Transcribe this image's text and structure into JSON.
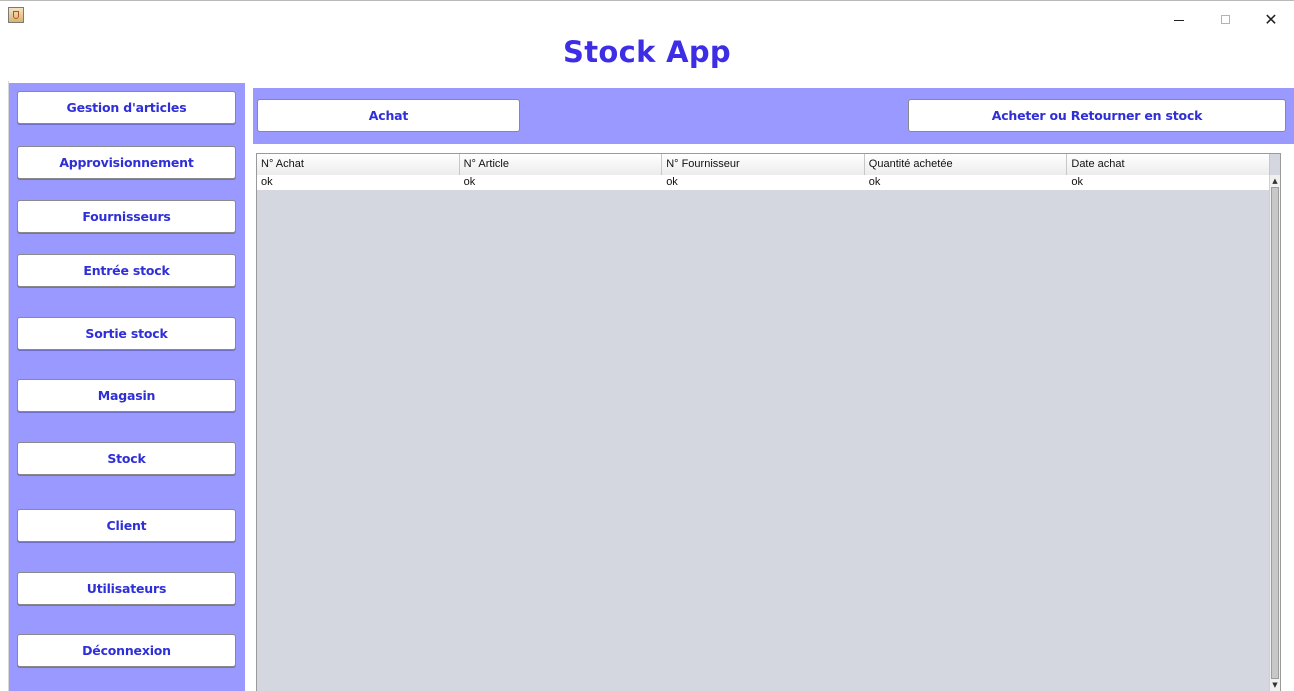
{
  "window": {
    "title": "Stock App",
    "icon": "java-cup-icon",
    "controls": {
      "minimize": "minimize-icon",
      "maximize": "maximize-icon",
      "close": "close-icon"
    }
  },
  "sidebar": {
    "items": [
      {
        "label": "Gestion d'articles"
      },
      {
        "label": "Approvisionnement"
      },
      {
        "label": "Fournisseurs"
      },
      {
        "label": "Entrée stock"
      },
      {
        "label": "Sortie stock"
      },
      {
        "label": "Magasin"
      },
      {
        "label": "Stock"
      },
      {
        "label": "Client"
      },
      {
        "label": "Utilisateurs"
      },
      {
        "label": "Déconnexion"
      }
    ]
  },
  "actions": {
    "achat_label": "Achat",
    "buy_return_label": "Acheter ou Retourner en stock"
  },
  "table": {
    "columns": [
      "N° Achat",
      "N° Article",
      "N° Fournisseur",
      "Quantité achetée",
      "Date achat"
    ],
    "rows": [
      [
        "ok",
        "ok",
        "ok",
        "ok",
        "ok"
      ]
    ]
  },
  "colors": {
    "accent": "#3d2ee6",
    "panel": "#9999ff",
    "button_text": "#2f2fd8",
    "table_bg": "#d5d7e0"
  }
}
